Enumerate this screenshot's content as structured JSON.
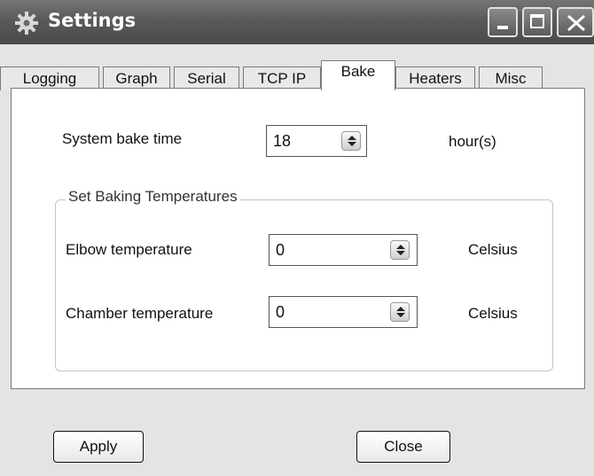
{
  "window": {
    "title": "Settings"
  },
  "tabs": [
    {
      "label": "Logging"
    },
    {
      "label": "Graph"
    },
    {
      "label": "Serial"
    },
    {
      "label": "TCP IP"
    },
    {
      "label": "Bake"
    },
    {
      "label": "Heaters"
    },
    {
      "label": "Misc"
    }
  ],
  "active_tab": "Bake",
  "bake": {
    "bake_time_label": "System bake time",
    "bake_time_value": "18",
    "bake_time_unit": "hour(s)",
    "group_title": "Set Baking Temperatures",
    "elbow_label": "Elbow temperature",
    "elbow_value": "0",
    "elbow_unit": "Celsius",
    "chamber_label": "Chamber temperature",
    "chamber_value": "0",
    "chamber_unit": "Celsius"
  },
  "buttons": {
    "apply": "Apply",
    "close": "Close"
  },
  "icons": {
    "app": "gear-icon",
    "minimize": "minimize-icon",
    "maximize": "maximize-icon",
    "close": "close-icon",
    "spinner": "up-down-arrows-icon"
  }
}
